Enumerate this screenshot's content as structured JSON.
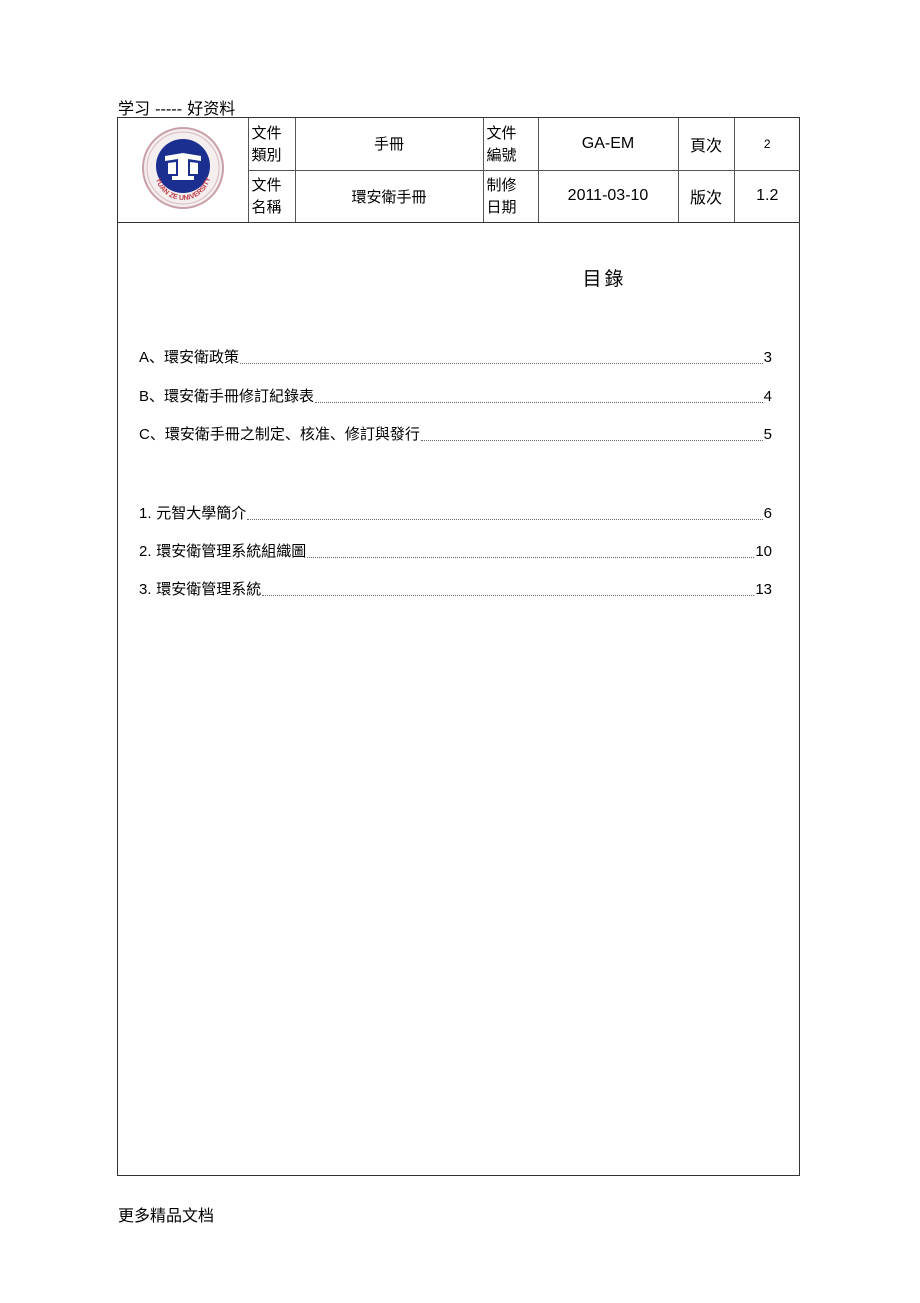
{
  "page_header_note": "学习 ----- 好资料",
  "page_footer_note": "更多精品文档",
  "doc_info": {
    "logo": "yuan-ze-university-logo",
    "logo_text": "YUAN ZE UNIVERSITY",
    "row1": {
      "label1": [
        "文件",
        "類別"
      ],
      "value1": "手冊",
      "label2": [
        "文件",
        "編號"
      ],
      "value2": "GA-EM",
      "label3": "頁次",
      "value3": "2"
    },
    "row2": {
      "label1": [
        "文件",
        "名稱"
      ],
      "value1": "環安衛手冊",
      "label2": [
        "制修",
        "日期"
      ],
      "value2": "2011-03-10",
      "label3": "版次",
      "value3": "1.2"
    }
  },
  "toc": {
    "title": "目錄",
    "items": [
      {
        "prefix": "A",
        "sep": "、",
        "text": "環安衛政策",
        "page": "3"
      },
      {
        "prefix": "B",
        "sep": "、",
        "text": "環安衛手冊修訂紀錄表",
        "page": "4"
      },
      {
        "prefix": "C",
        "sep": "、",
        "text": "環安衛手冊之制定、核准、修訂與發行",
        "page": "5"
      },
      {
        "prefix": "1.",
        "sep": " ",
        "text": "元智大學簡介",
        "page": "6"
      },
      {
        "prefix": "2.",
        "sep": " ",
        "text": "環安衛管理系統組織圖",
        "page": "10"
      },
      {
        "prefix": "3.",
        "sep": " ",
        "text": "環安衛管理系統",
        "page": "13"
      }
    ]
  }
}
